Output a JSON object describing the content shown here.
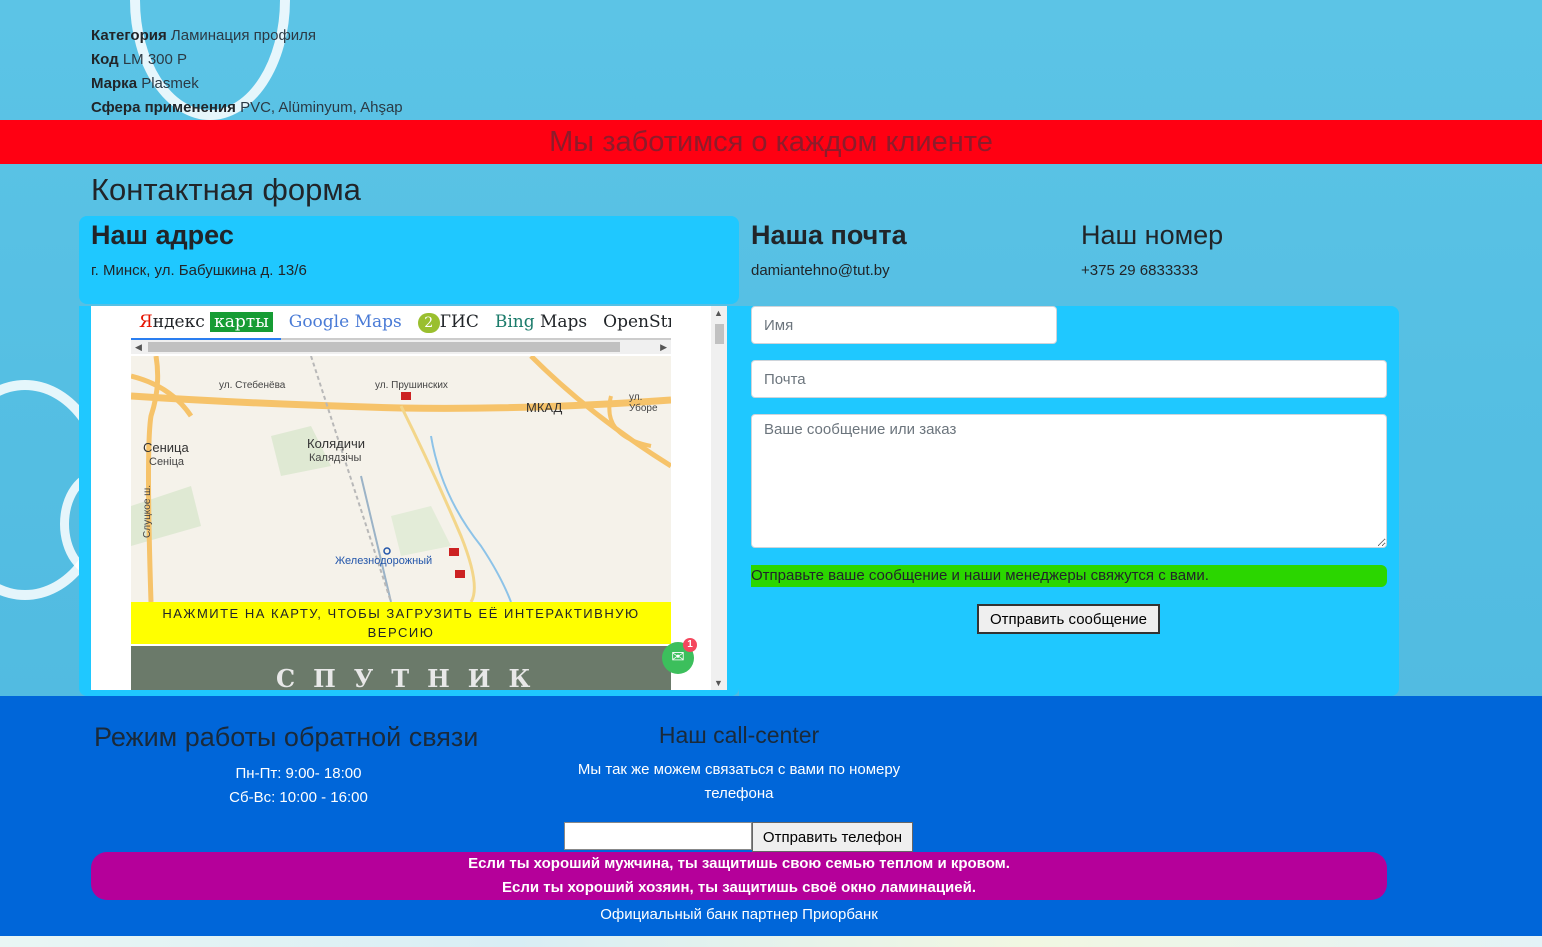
{
  "product": {
    "category_label": "Категория",
    "category_value": "Ламинация профиля",
    "code_label": "Код",
    "code_value": "LM 300 P",
    "brand_label": "Марка",
    "brand_value": "Plasmek",
    "sphere_label": "Сфера применения",
    "sphere_value": "PVC, Alüminyum, Ahşap"
  },
  "banner": {
    "text": "Мы заботимся о каждом клиенте",
    "color": "#ff0012"
  },
  "contact": {
    "title": "Контактная форма",
    "address_title": "Наш адрес",
    "address": "г. Минск, ул. Бабушкина д. 13/6",
    "mail_title": "Наша почта",
    "mail": "damiantehno@tut.by",
    "phone_title": "Наш номер",
    "phone": "+375 29 6833333"
  },
  "map": {
    "tabs": {
      "yandex_a": "Я",
      "yandex_b": "ндекс",
      "yandex_c": "карты",
      "google_1": "Google",
      "google_2": " Maps",
      "gis_num": "2",
      "gis_text": "ГИС",
      "bing_1": "Bing",
      "bing_2": " Maps",
      "osm": "OpenStreetM"
    },
    "labels": {
      "steb": "ул. Стебенёва",
      "prush": "ул. Прушинских",
      "mkad": "МКАД",
      "ubor": "ул. Уборе",
      "kolyad1": "Колядичи",
      "kolyad2": "Калядзічы",
      "sen1": "Сеница",
      "sen2": "Сеніца",
      "sluck": "Слуцкое ш.",
      "zhd": "Железнодорожный"
    },
    "note": "НАЖМИТЕ НА КАРТУ, ЧТОБЫ ЗАГРУЗИТЬ ЕЁ ИНТЕРАКТИВНУЮ ВЕРСИЮ",
    "satellite": "СПУТНИК",
    "badge_count": "1"
  },
  "form": {
    "name_placeholder": "Имя",
    "email_placeholder": "Почта",
    "message_placeholder": "Ваше сообщение или заказ",
    "note": "Отправьте ваше сообщение и наши менеджеры свяжутся с вами.",
    "submit_label": "Отправить сообщение"
  },
  "footer": {
    "hours_title": "Режим работы обратной связи",
    "hours_weekdays": "Пн-Пт: 9:00- 18:00",
    "hours_weekend": "Сб-Вс: 10:00 - 16:00",
    "call_title": "Наш call-center",
    "call_text_1": "Мы так же можем связаться с вами по номеру",
    "call_text_2": "телефона",
    "phone_button": "Отправить телефон",
    "quote_1": "Если ты хороший мужчина, ты защитишь свою семью теплом и кровом.",
    "quote_2": "Если ты хороший хозяин, ты защитишь своё окно ламинацией.",
    "bank": "Официальный банк партнер Приорбанк"
  },
  "colors": {
    "accent_cyan": "#1fc8ff",
    "footer_blue": "#0066d9",
    "quote_purple": "#b5009a",
    "note_green": "#2bd600"
  }
}
